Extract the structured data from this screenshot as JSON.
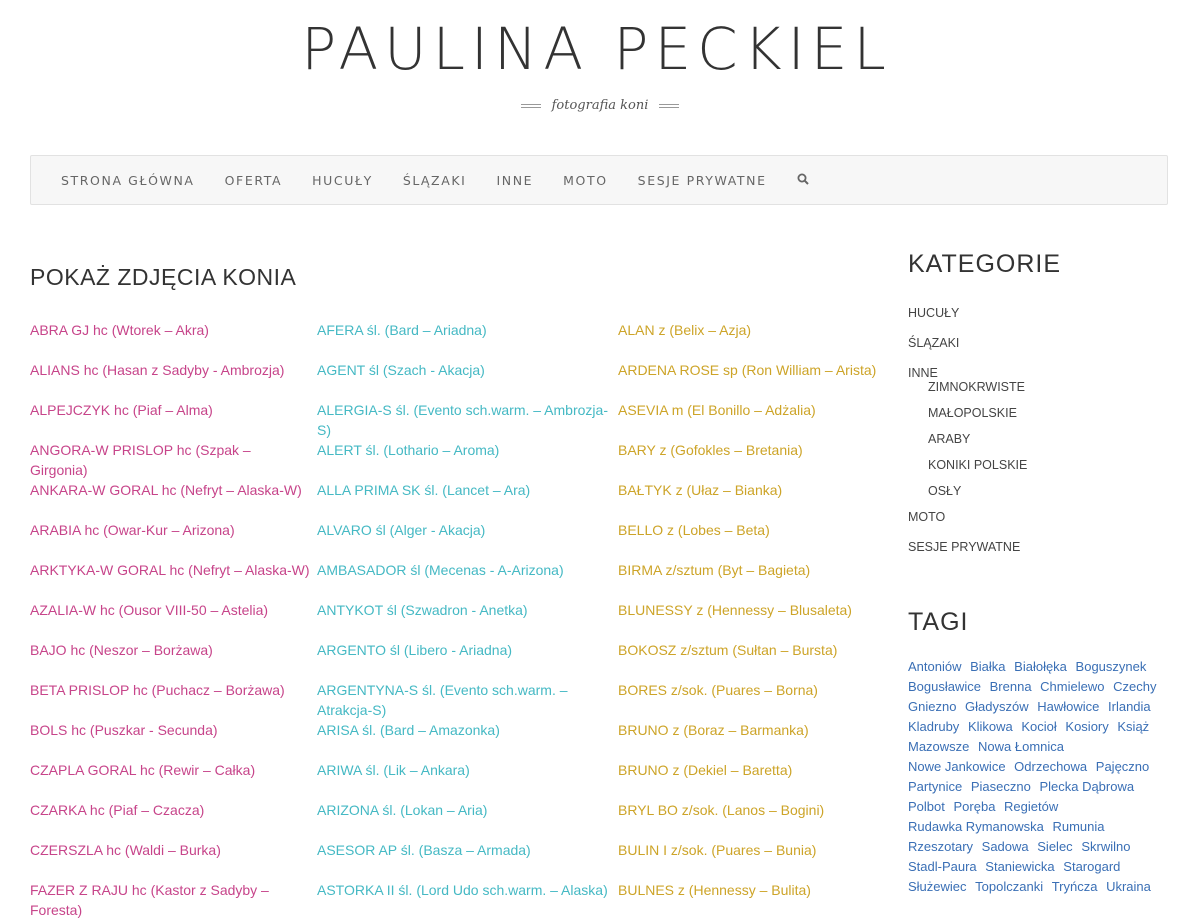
{
  "site": {
    "title": "PAULINA PECKIEL",
    "tagline": "fotografia koni"
  },
  "nav": {
    "items": [
      "STRONA GŁÓWNA",
      "OFERTA",
      "HUCUŁY",
      "ŚLĄZAKI",
      "INNE",
      "MOTO",
      "SESJE PRYWATNE"
    ],
    "search_icon": "search-icon"
  },
  "main": {
    "heading": "POKAŻ ZDJĘCIA KONIA",
    "col1": [
      "ABRA GJ hc (Wtorek – Akra)",
      "ALIANS hc (Hasan z Sadyby - Ambrozja)",
      "ALPEJCZYK hc (Piaf – Alma)",
      "ANGORA-W PRISLOP hc (Szpak – Girgonia)",
      "ANKARA-W GORAL hc (Nefryt – Alaska-W)",
      "ARABIA hc (Owar-Kur – Arizona)",
      "ARKTYKA-W GORAL hc (Nefryt – Alaska-W)",
      "AZALIA-W hc (Ousor VIII-50 – Astelia)",
      "BAJO hc (Neszor – Borżawa)",
      "BETA PRISLOP hc (Puchacz – Borżawa)",
      "BOLS hc (Puszkar - Secunda)",
      "CZAPLA GORAL hc (Rewir – Całka)",
      "CZARKA hc (Piaf – Czacza)",
      "CZERSZLA hc (Waldi – Burka)",
      "FAZER Z RAJU hc (Kastor z Sadyby – Foresta)"
    ],
    "col2": [
      "AFERA śl. (Bard – Ariadna)",
      "AGENT śl (Szach - Akacja)",
      "ALERGIA-S śl. (Evento sch.warm. – Ambrozja-S)",
      "ALERT śl. (Lothario – Aroma)",
      "ALLA PRIMA SK śl. (Lancet – Ara)",
      "ALVARO śl (Alger - Akacja)",
      "AMBASADOR śl (Mecenas - A-Arizona)",
      "ANTYKOT śl (Szwadron - Anetka)",
      "ARGENTO śl (Libero - Ariadna)",
      "ARGENTYNA-S śl. (Evento sch.warm. – Atrakcja-S)",
      "ARISA śl. (Bard – Amazonka)",
      "ARIWA śl. (Lik – Ankara)",
      "ARIZONA śl. (Lokan – Aria)",
      "ASESOR AP śl. (Basza – Armada)",
      "ASTORKA II śl. (Lord Udo sch.warm. – Alaska)"
    ],
    "col3": [
      "ALAN z (Belix – Azja)",
      "ARDENA ROSE sp (Ron William – Arista)",
      "ASEVIA m (El Bonillo – Adżalia)",
      "BARY z (Gofokles – Bretania)",
      "BAŁTYK z (Ułaz – Bianka)",
      "BELLO z (Lobes – Beta)",
      "BIRMA z/sztum (Byt – Bagieta)",
      "BLUNESSY z (Hennessy – Blusaleta)",
      "BOKOSZ z/sztum (Sułtan – Bursta)",
      "BORES z/sok. (Puares – Borna)",
      "BRUNO z (Boraz – Barmanka)",
      "BRUNO z (Dekiel – Baretta)",
      "BRYL BO z/sok. (Lanos – Bogini)",
      "BULIN I z/sok. (Puares – Bunia)",
      "BULNES z (Hennessy – Bulita)"
    ]
  },
  "sidebar": {
    "categories_title": "KATEGORIE",
    "categories": [
      {
        "label": "HUCUŁY",
        "sub": false
      },
      {
        "label": "ŚLĄZAKI",
        "sub": false
      },
      {
        "label": "INNE",
        "sub": false
      },
      {
        "label": "ZIMNOKRWISTE",
        "sub": true
      },
      {
        "label": "MAŁOPOLSKIE",
        "sub": true
      },
      {
        "label": "ARABY",
        "sub": true
      },
      {
        "label": "KONIKI POLSKIE",
        "sub": true
      },
      {
        "label": "OSŁY",
        "sub": true
      },
      {
        "label": "MOTO",
        "sub": false
      },
      {
        "label": "SESJE PRYWATNE",
        "sub": false
      }
    ],
    "tags_title": "TAGI",
    "tags": [
      "Antoniów",
      "Białka",
      "Białołęka",
      "Boguszynek",
      "Bogusławice",
      "Brenna",
      "Chmielewo",
      "Czechy",
      "Gniezno",
      "Gładyszów",
      "Hawłowice",
      "Irlandia",
      "Kladruby",
      "Klikowa",
      "Kocioł",
      "Kosiory",
      "Książ",
      "Mazowsze",
      "Nowa Łomnica",
      "Nowe Jankowice",
      "Odrzechowa",
      "Pajęczno",
      "Partynice",
      "Piaseczno",
      "Plecka Dąbrowa",
      "Polbot",
      "Poręba",
      "Regietów",
      "Rudawka Rymanowska",
      "Rumunia",
      "Rzeszotary",
      "Sadowa",
      "Sielec",
      "Skrwilno",
      "Stadl-Paura",
      "Staniewicka",
      "Starogard",
      "Służewiec",
      "Topolczanki",
      "Tryńcza",
      "Ukraina"
    ],
    "tag_color": "#3a6fb5"
  },
  "colors": {
    "hucul": "#c7448a",
    "slazak": "#45b9c4",
    "inne": "#cda428"
  }
}
